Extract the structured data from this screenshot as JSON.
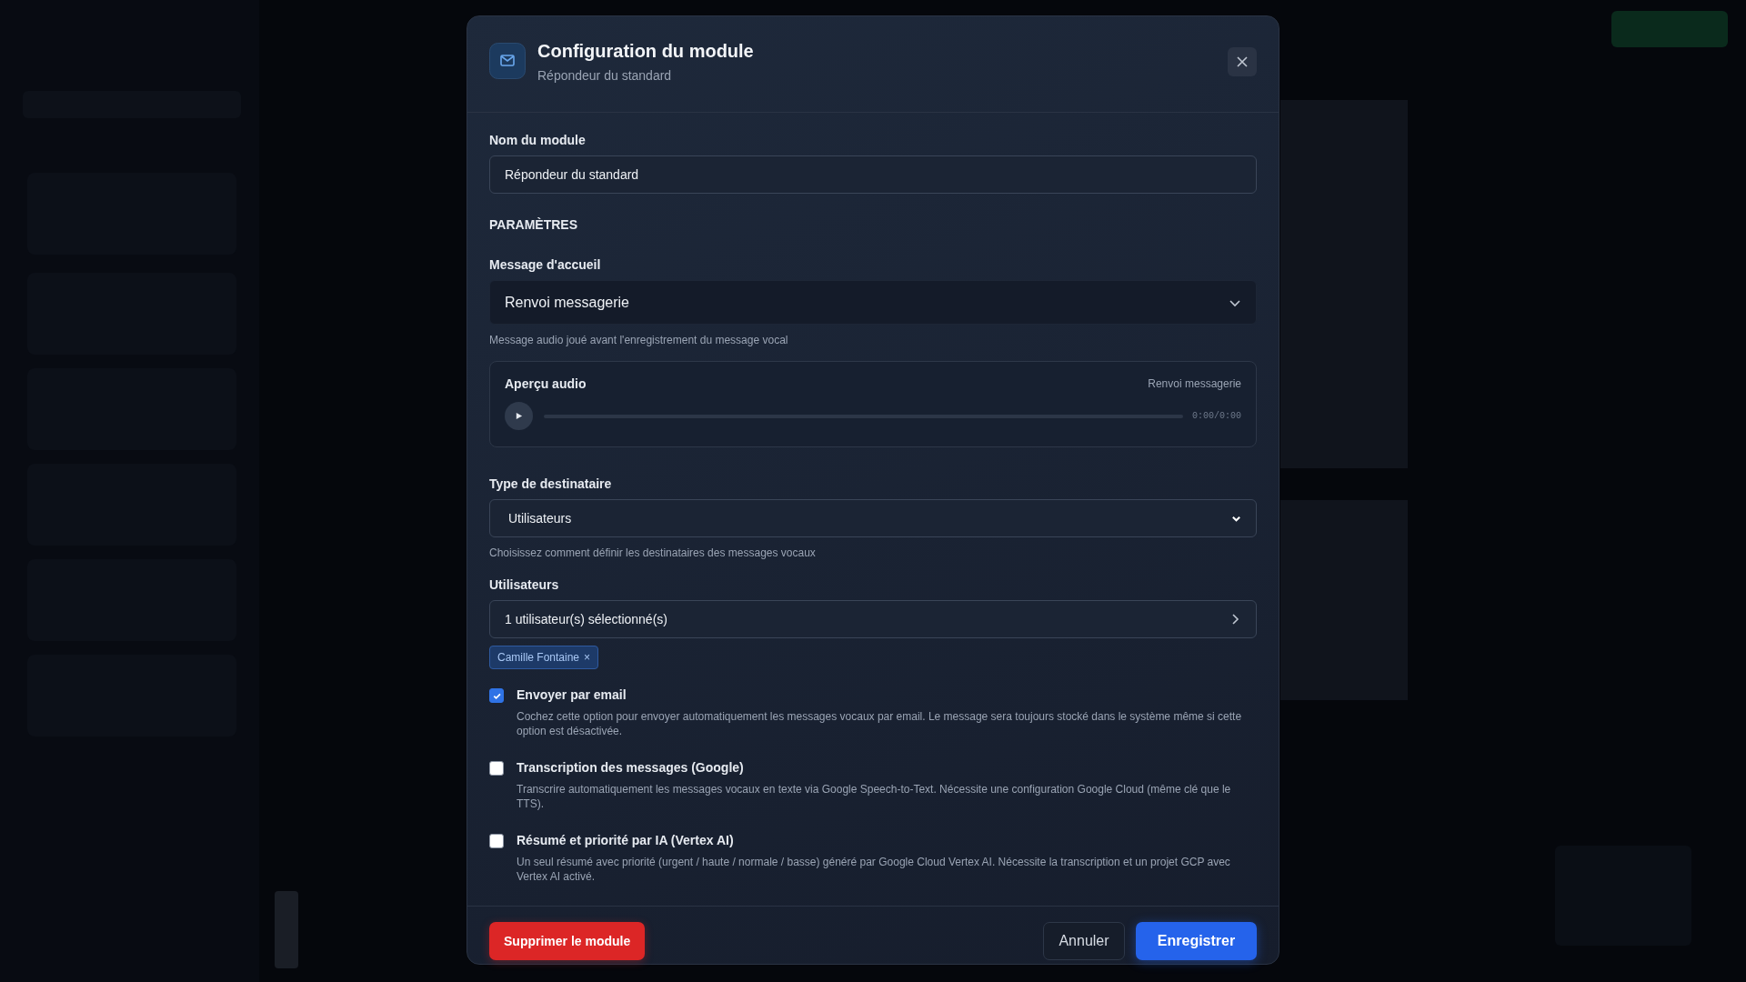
{
  "dialog": {
    "title": "Configuration du module",
    "subtitle": "Répondeur du standard"
  },
  "name_field": {
    "label": "Nom du module",
    "value": "Répondeur du standard"
  },
  "section_title": "PARAMÈTRES",
  "greeting": {
    "label": "Message d'accueil",
    "value": "Renvoi messagerie",
    "hint": "Message audio joué avant l'enregistrement du message vocal"
  },
  "audio_preview": {
    "title": "Aperçu audio",
    "source": "Renvoi messagerie",
    "time": "0:00/0:00"
  },
  "recipient_type": {
    "label": "Type de destinataire",
    "value": "Utilisateurs",
    "hint": "Choisissez comment définir les destinataires des messages vocaux"
  },
  "users": {
    "label": "Utilisateurs",
    "summary": "1 utilisateur(s) sélectionné(s)",
    "chips": [
      {
        "name": "Camille Fontaine",
        "remove": "×"
      }
    ]
  },
  "options": [
    {
      "label": "Envoyer par email",
      "checked": true,
      "description": "Cochez cette option pour envoyer automatiquement les messages vocaux par email. Le message sera toujours stocké dans le système même si cette option est désactivée."
    },
    {
      "label": "Transcription des messages (Google)",
      "checked": false,
      "description": "Transcrire automatiquement les messages vocaux en texte via Google Speech-to-Text. Nécessite une configuration Google Cloud (même clé que le TTS)."
    },
    {
      "label": "Résumé et priorité par IA (Vertex AI)",
      "checked": false,
      "description": "Un seul résumé avec priorité (urgent / haute / normale / basse) généré par Google Cloud Vertex AI. Nécessite la transcription et un projet GCP avec Vertex AI activé."
    }
  ],
  "footer": {
    "delete": "Supprimer le module",
    "cancel": "Annuler",
    "save": "Enregistrer"
  }
}
